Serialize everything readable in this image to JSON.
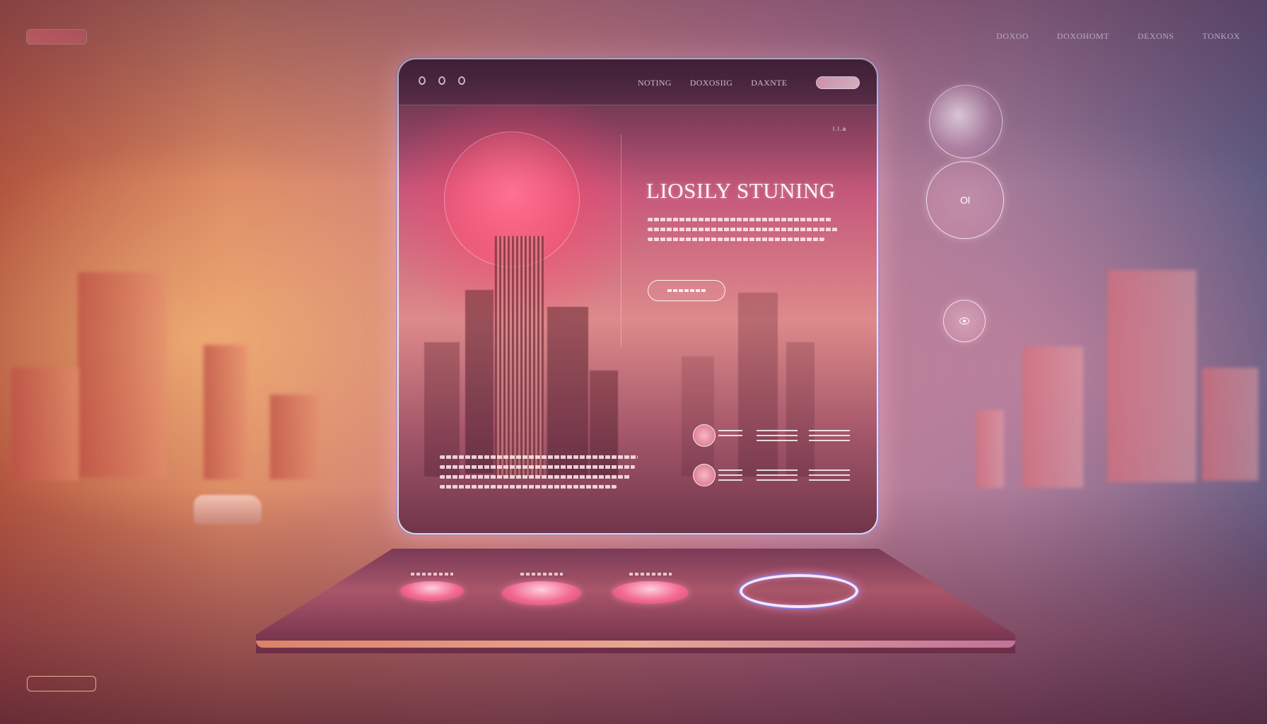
{
  "top_nav": [
    "DOXOO",
    "DOXOHOMT",
    "DEXONS",
    "TONKOX"
  ],
  "window": {
    "nav": [
      "NOTING",
      "DOXOSIIG",
      "DAXNTE"
    ],
    "marker": "l.l.a",
    "hero_title": "LIOSILY STUNING"
  },
  "side_bubbles": {
    "middle_label": "Ol"
  },
  "icons": [
    "eye-icon"
  ],
  "colors": {
    "accent_pink": "#f26a92",
    "background_orange": "#d98662",
    "background_violet": "#5e5a80"
  }
}
